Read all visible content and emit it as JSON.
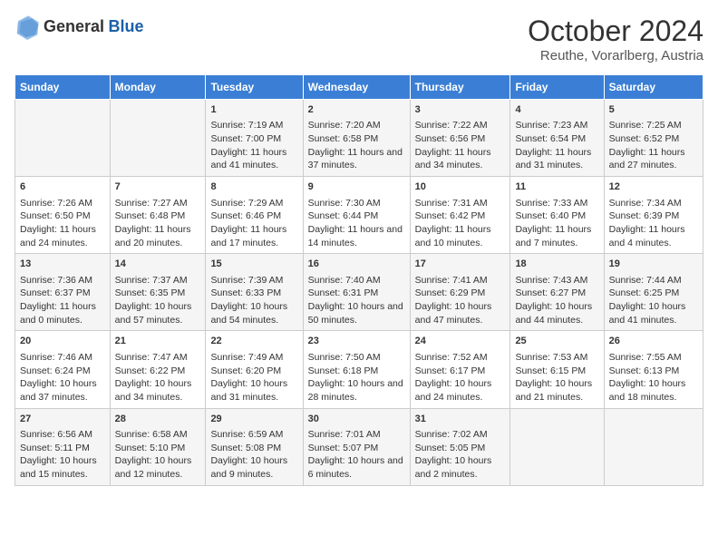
{
  "logo": {
    "text_general": "General",
    "text_blue": "Blue"
  },
  "title": "October 2024",
  "subtitle": "Reuthe, Vorarlberg, Austria",
  "days_of_week": [
    "Sunday",
    "Monday",
    "Tuesday",
    "Wednesday",
    "Thursday",
    "Friday",
    "Saturday"
  ],
  "weeks": [
    [
      {
        "day": "",
        "content": ""
      },
      {
        "day": "",
        "content": ""
      },
      {
        "day": "1",
        "content": "Sunrise: 7:19 AM\nSunset: 7:00 PM\nDaylight: 11 hours and 41 minutes."
      },
      {
        "day": "2",
        "content": "Sunrise: 7:20 AM\nSunset: 6:58 PM\nDaylight: 11 hours and 37 minutes."
      },
      {
        "day": "3",
        "content": "Sunrise: 7:22 AM\nSunset: 6:56 PM\nDaylight: 11 hours and 34 minutes."
      },
      {
        "day": "4",
        "content": "Sunrise: 7:23 AM\nSunset: 6:54 PM\nDaylight: 11 hours and 31 minutes."
      },
      {
        "day": "5",
        "content": "Sunrise: 7:25 AM\nSunset: 6:52 PM\nDaylight: 11 hours and 27 minutes."
      }
    ],
    [
      {
        "day": "6",
        "content": "Sunrise: 7:26 AM\nSunset: 6:50 PM\nDaylight: 11 hours and 24 minutes."
      },
      {
        "day": "7",
        "content": "Sunrise: 7:27 AM\nSunset: 6:48 PM\nDaylight: 11 hours and 20 minutes."
      },
      {
        "day": "8",
        "content": "Sunrise: 7:29 AM\nSunset: 6:46 PM\nDaylight: 11 hours and 17 minutes."
      },
      {
        "day": "9",
        "content": "Sunrise: 7:30 AM\nSunset: 6:44 PM\nDaylight: 11 hours and 14 minutes."
      },
      {
        "day": "10",
        "content": "Sunrise: 7:31 AM\nSunset: 6:42 PM\nDaylight: 11 hours and 10 minutes."
      },
      {
        "day": "11",
        "content": "Sunrise: 7:33 AM\nSunset: 6:40 PM\nDaylight: 11 hours and 7 minutes."
      },
      {
        "day": "12",
        "content": "Sunrise: 7:34 AM\nSunset: 6:39 PM\nDaylight: 11 hours and 4 minutes."
      }
    ],
    [
      {
        "day": "13",
        "content": "Sunrise: 7:36 AM\nSunset: 6:37 PM\nDaylight: 11 hours and 0 minutes."
      },
      {
        "day": "14",
        "content": "Sunrise: 7:37 AM\nSunset: 6:35 PM\nDaylight: 10 hours and 57 minutes."
      },
      {
        "day": "15",
        "content": "Sunrise: 7:39 AM\nSunset: 6:33 PM\nDaylight: 10 hours and 54 minutes."
      },
      {
        "day": "16",
        "content": "Sunrise: 7:40 AM\nSunset: 6:31 PM\nDaylight: 10 hours and 50 minutes."
      },
      {
        "day": "17",
        "content": "Sunrise: 7:41 AM\nSunset: 6:29 PM\nDaylight: 10 hours and 47 minutes."
      },
      {
        "day": "18",
        "content": "Sunrise: 7:43 AM\nSunset: 6:27 PM\nDaylight: 10 hours and 44 minutes."
      },
      {
        "day": "19",
        "content": "Sunrise: 7:44 AM\nSunset: 6:25 PM\nDaylight: 10 hours and 41 minutes."
      }
    ],
    [
      {
        "day": "20",
        "content": "Sunrise: 7:46 AM\nSunset: 6:24 PM\nDaylight: 10 hours and 37 minutes."
      },
      {
        "day": "21",
        "content": "Sunrise: 7:47 AM\nSunset: 6:22 PM\nDaylight: 10 hours and 34 minutes."
      },
      {
        "day": "22",
        "content": "Sunrise: 7:49 AM\nSunset: 6:20 PM\nDaylight: 10 hours and 31 minutes."
      },
      {
        "day": "23",
        "content": "Sunrise: 7:50 AM\nSunset: 6:18 PM\nDaylight: 10 hours and 28 minutes."
      },
      {
        "day": "24",
        "content": "Sunrise: 7:52 AM\nSunset: 6:17 PM\nDaylight: 10 hours and 24 minutes."
      },
      {
        "day": "25",
        "content": "Sunrise: 7:53 AM\nSunset: 6:15 PM\nDaylight: 10 hours and 21 minutes."
      },
      {
        "day": "26",
        "content": "Sunrise: 7:55 AM\nSunset: 6:13 PM\nDaylight: 10 hours and 18 minutes."
      }
    ],
    [
      {
        "day": "27",
        "content": "Sunrise: 6:56 AM\nSunset: 5:11 PM\nDaylight: 10 hours and 15 minutes."
      },
      {
        "day": "28",
        "content": "Sunrise: 6:58 AM\nSunset: 5:10 PM\nDaylight: 10 hours and 12 minutes."
      },
      {
        "day": "29",
        "content": "Sunrise: 6:59 AM\nSunset: 5:08 PM\nDaylight: 10 hours and 9 minutes."
      },
      {
        "day": "30",
        "content": "Sunrise: 7:01 AM\nSunset: 5:07 PM\nDaylight: 10 hours and 6 minutes."
      },
      {
        "day": "31",
        "content": "Sunrise: 7:02 AM\nSunset: 5:05 PM\nDaylight: 10 hours and 2 minutes."
      },
      {
        "day": "",
        "content": ""
      },
      {
        "day": "",
        "content": ""
      }
    ]
  ]
}
